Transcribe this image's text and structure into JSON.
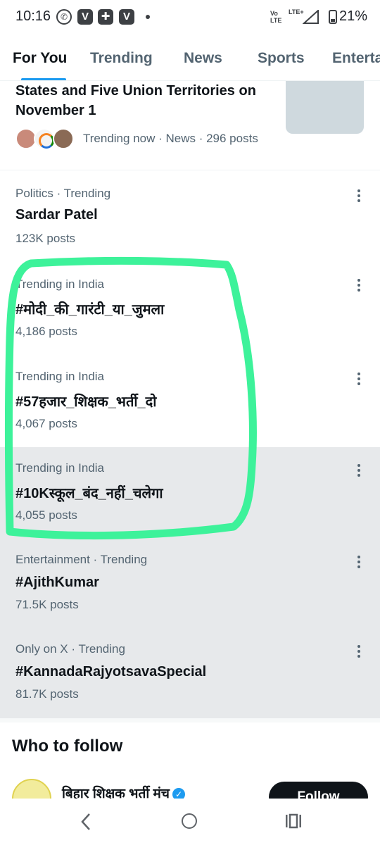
{
  "status_bar": {
    "time": "10:16",
    "network_volte": "Vo LTE",
    "network_lte": "LTE+",
    "battery": "21%"
  },
  "tabs": [
    {
      "label": "For You",
      "active": true
    },
    {
      "label": "Trending"
    },
    {
      "label": "News"
    },
    {
      "label": "Sports"
    },
    {
      "label": "Enterta"
    }
  ],
  "top_card": {
    "title": "States and Five Union Territories on November 1",
    "meta": "Trending now · News · 296 posts"
  },
  "trends": [
    {
      "context": "Politics · Trending",
      "title": "Sardar Patel",
      "count": "123K posts"
    },
    {
      "context": "Trending in India",
      "title": "#मोदी_की_गारंटी_या_जुमला",
      "count": "4,186 posts"
    },
    {
      "context": "Trending in India",
      "title": "#57हजार_शिक्षक_भर्ती_दो",
      "count": "4,067 posts"
    },
    {
      "context": "Trending in India",
      "title": "#10Kस्कूल_बंद_नहीं_चलेगा",
      "count": "4,055 posts"
    },
    {
      "context": "Entertainment · Trending",
      "title": "#AjithKumar",
      "count": "71.5K posts"
    },
    {
      "context": "Only on X · Trending",
      "title": "#KannadaRajyotsavaSpecial",
      "count": "81.7K posts"
    }
  ],
  "who_to_follow": {
    "title": "Who to follow",
    "account_name": "बिहार शिक्षक भर्ती मंच",
    "follow_label": "Follow"
  },
  "colors": {
    "accent": "#1d9bf0",
    "highlight": "#3df29a",
    "row_hover": "#e7e9eb"
  }
}
